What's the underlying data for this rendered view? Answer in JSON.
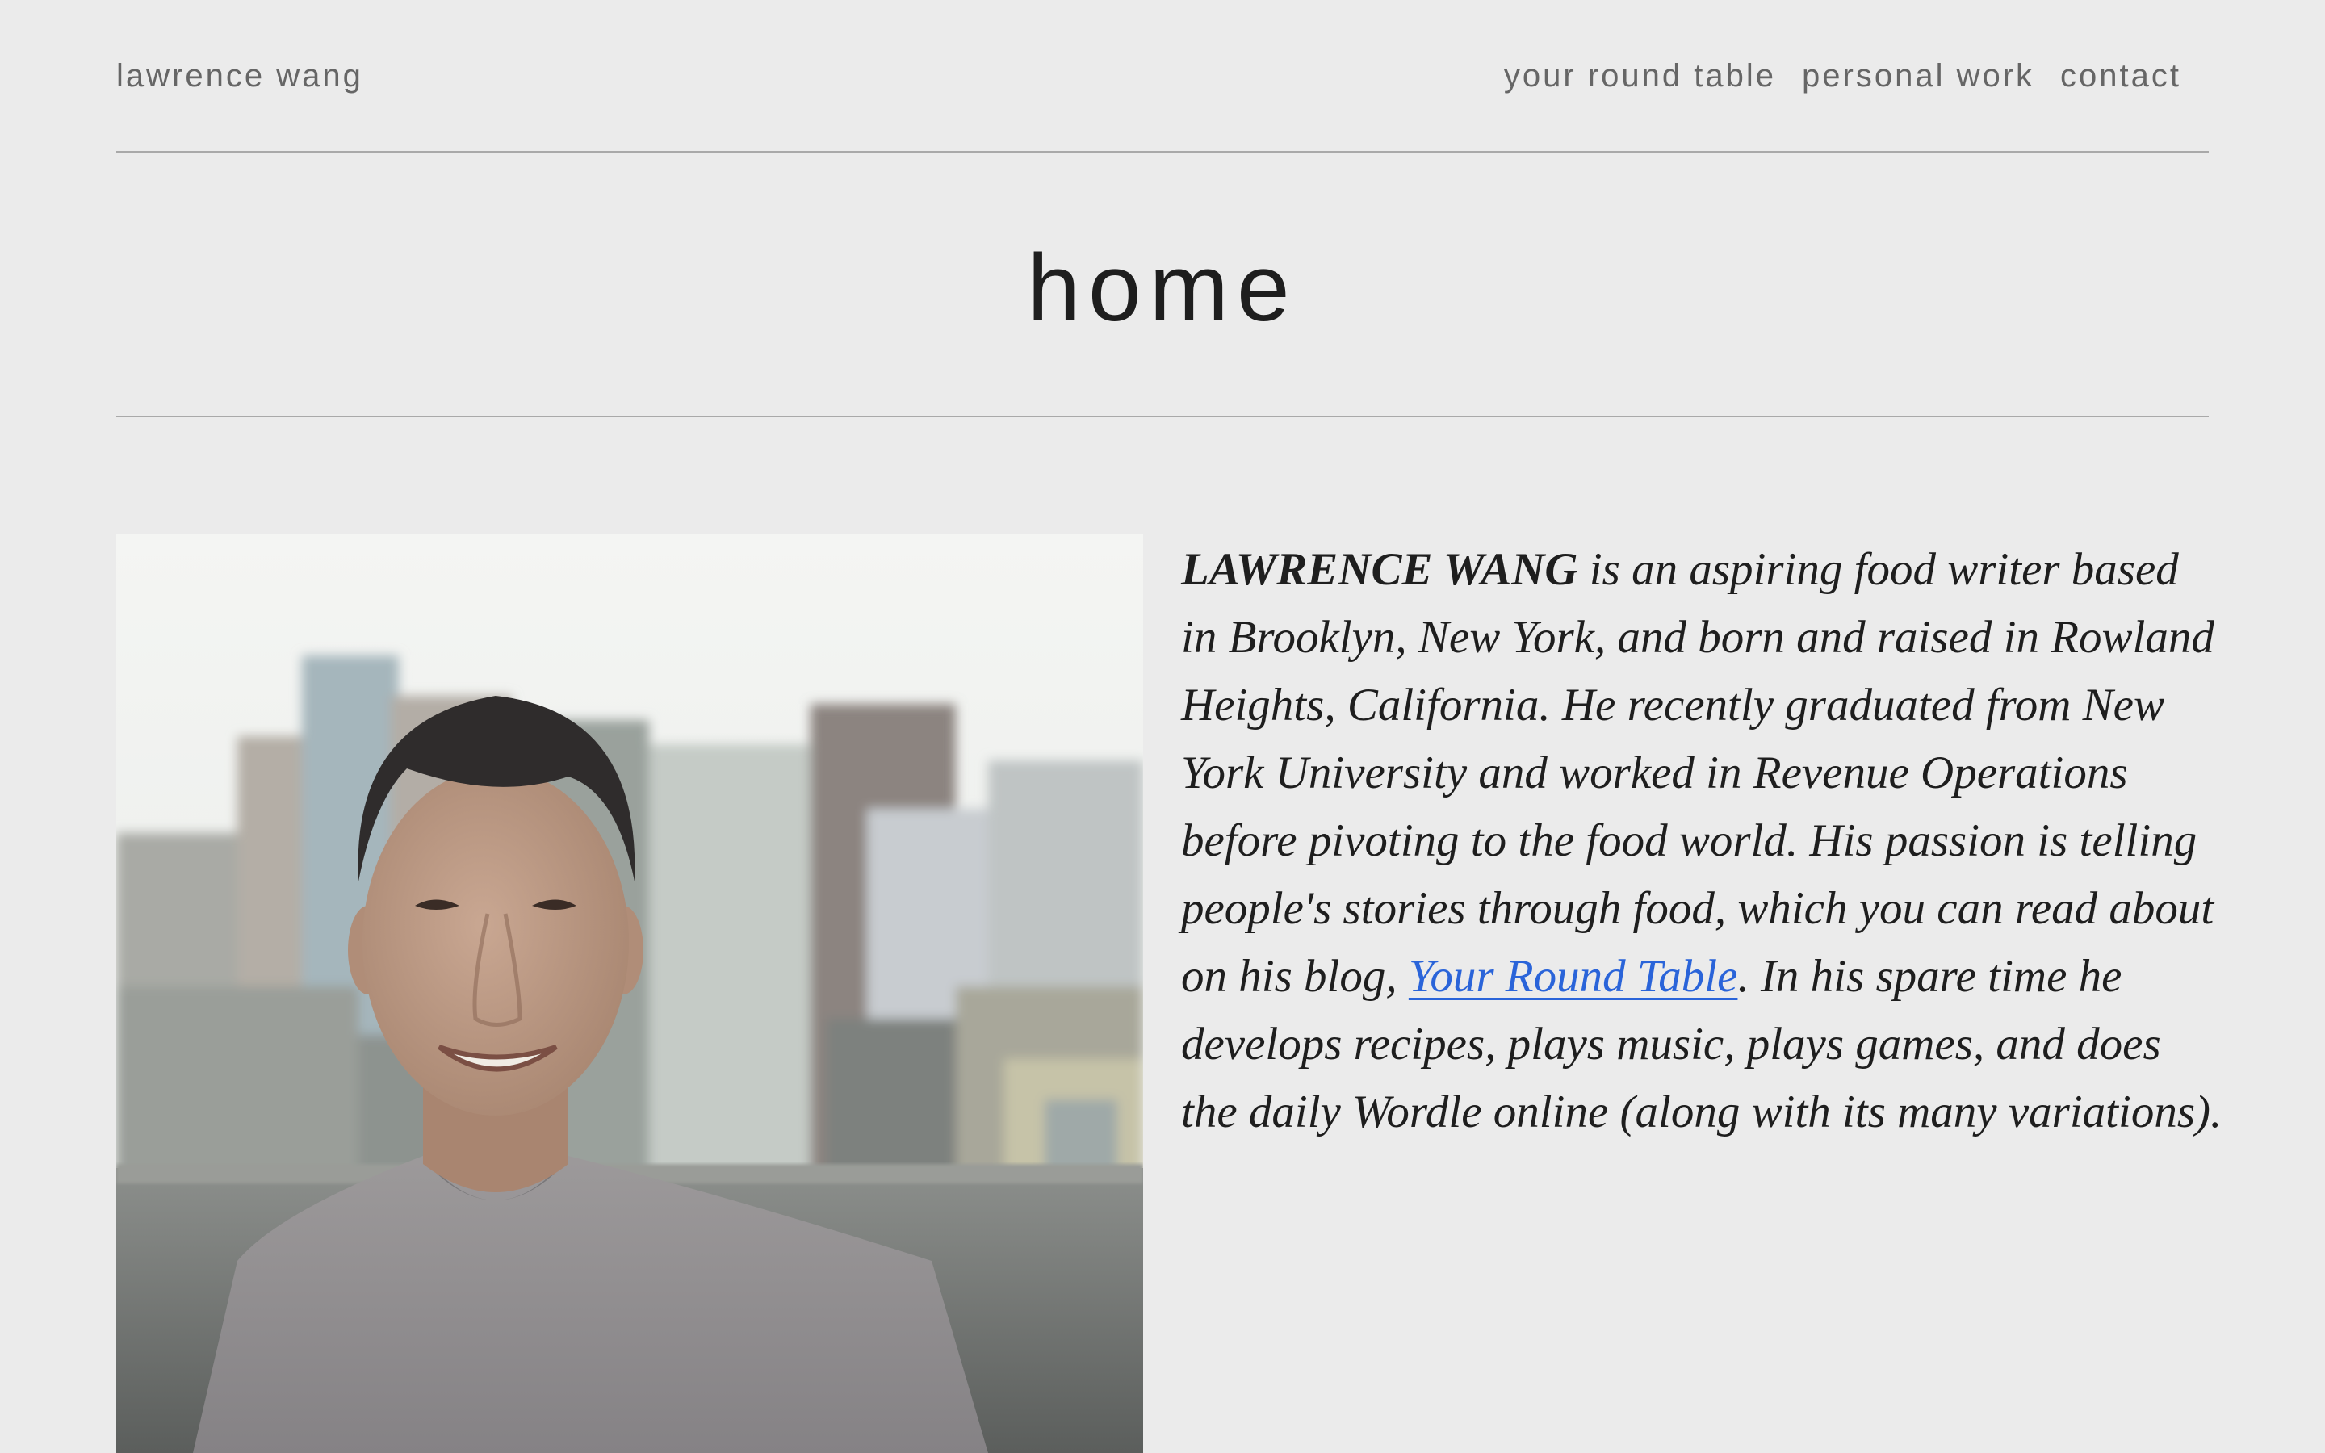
{
  "header": {
    "site_title": "lawrence wang",
    "nav": [
      {
        "label": "your round table"
      },
      {
        "label": "personal work"
      },
      {
        "label": "contact"
      }
    ]
  },
  "page": {
    "title": "home"
  },
  "portrait": {
    "alt": "portrait photo"
  },
  "bio": {
    "name": "LAWRENCE WANG",
    "text_before_link": " is an aspiring food writer based in Brooklyn, New York, and born and raised in Rowland Heights, California. He recently graduated from New York University and worked in Revenue Operations before pivoting to the food world. His passion is telling people's stories through food, which you can read about on his blog, ",
    "link_label": "Your Round Table",
    "text_after_link": ". In his spare time he develops recipes, plays music, plays games, and does the daily Wordle online (along with its many variations)."
  },
  "colors": {
    "background": "#ebebeb",
    "text": "#1e1e1e",
    "nav_text": "#666666",
    "link": "#2a64d9",
    "rule": "#a9a9a9"
  }
}
